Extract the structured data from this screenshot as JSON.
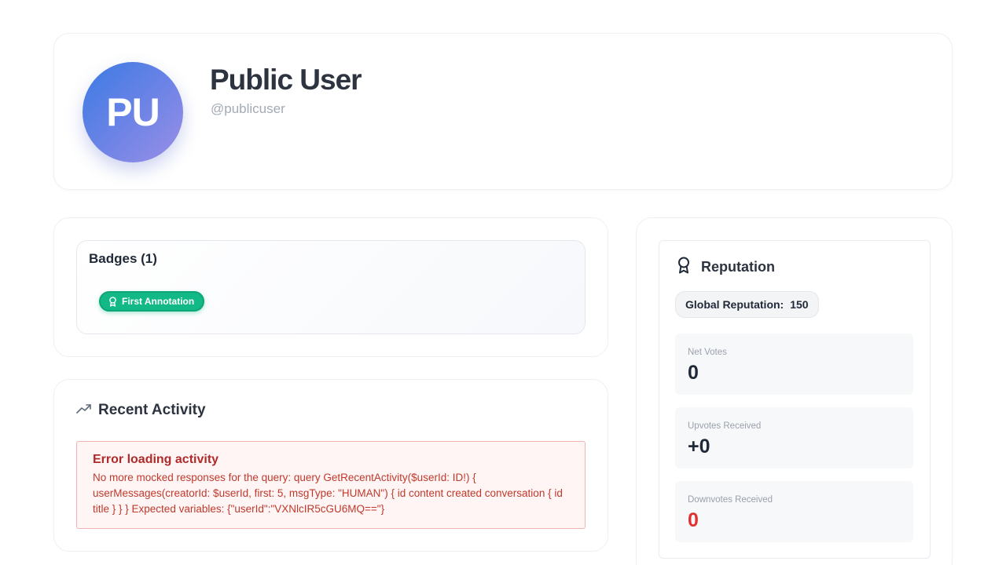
{
  "profile": {
    "initials": "PU",
    "name": "Public User",
    "handle": "@publicuser"
  },
  "badges": {
    "title": "Badges (1)",
    "items": [
      {
        "label": "First Annotation",
        "icon": "award-icon",
        "color": "#12b886"
      }
    ]
  },
  "activity": {
    "title": "Recent Activity",
    "icon": "trending-up-icon",
    "error": {
      "title": "Error loading activity",
      "message": "No more mocked responses for the query: query GetRecentActivity($userId: ID!) { userMessages(creatorId: $userId, first: 5, msgType: \"HUMAN\") { id content created conversation { id title } } } Expected variables: {\"userId\":\"VXNlcIR5cGU6MQ==\"}"
    }
  },
  "reputation": {
    "title": "Reputation",
    "icon": "award-icon",
    "global_label": "Global Reputation:",
    "global_value": "150",
    "stats": [
      {
        "label": "Net Votes",
        "value": "0",
        "color": "#1f2937"
      },
      {
        "label": "Upvotes Received",
        "value": "+0",
        "color": "#1f2937"
      },
      {
        "label": "Downvotes Received",
        "value": "0",
        "color": "#e03131"
      }
    ]
  },
  "colors": {
    "accent": "#3b7ae3",
    "badge_green": "#12b886",
    "error_text": "#c0392b",
    "error_bg": "#fff5f5"
  }
}
